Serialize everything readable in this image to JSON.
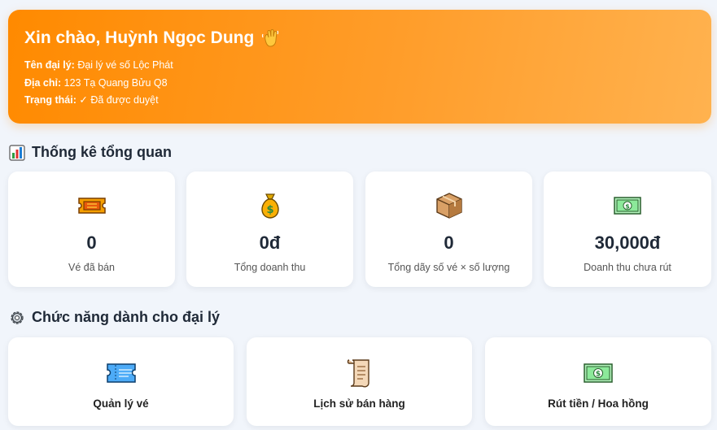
{
  "header": {
    "greeting": "Xin chào, Huỳnh Ngọc Dung",
    "agent_name_label": "Tên đại lý:",
    "agent_name": "Đại lý vé số Lộc Phát",
    "address_label": "Địa chỉ:",
    "address": "123 Tạ Quang Bửu Q8",
    "status_label": "Trạng thái:",
    "status": "✓ Đã được duyệt"
  },
  "stats_section": {
    "title": "Thống kê tổng quan",
    "icon": "bar-chart-icon",
    "cards": [
      {
        "icon": "ticket-icon",
        "value": "0",
        "label": "Vé đã bán"
      },
      {
        "icon": "money-bag-icon",
        "value": "0đ",
        "label": "Tổng doanh thu"
      },
      {
        "icon": "package-icon",
        "value": "0",
        "label": "Tổng dãy số vé × số lượng"
      },
      {
        "icon": "banknote-icon",
        "value": "30,000đ",
        "label": "Doanh thu chưa rút"
      }
    ]
  },
  "functions_section": {
    "title": "Chức năng dành cho đại lý",
    "icon": "gear-icon",
    "cards": [
      {
        "icon": "ticket-manage-icon",
        "label": "Quản lý vé"
      },
      {
        "icon": "scroll-icon",
        "label": "Lịch sử bán hàng"
      },
      {
        "icon": "banknote-icon",
        "label": "Rút tiền / Hoa hồng"
      }
    ]
  },
  "colors": {
    "header_gradient_start": "#ff8a00",
    "header_gradient_end": "#ffb24f",
    "background": "#f1f5fb",
    "card": "#ffffff"
  }
}
